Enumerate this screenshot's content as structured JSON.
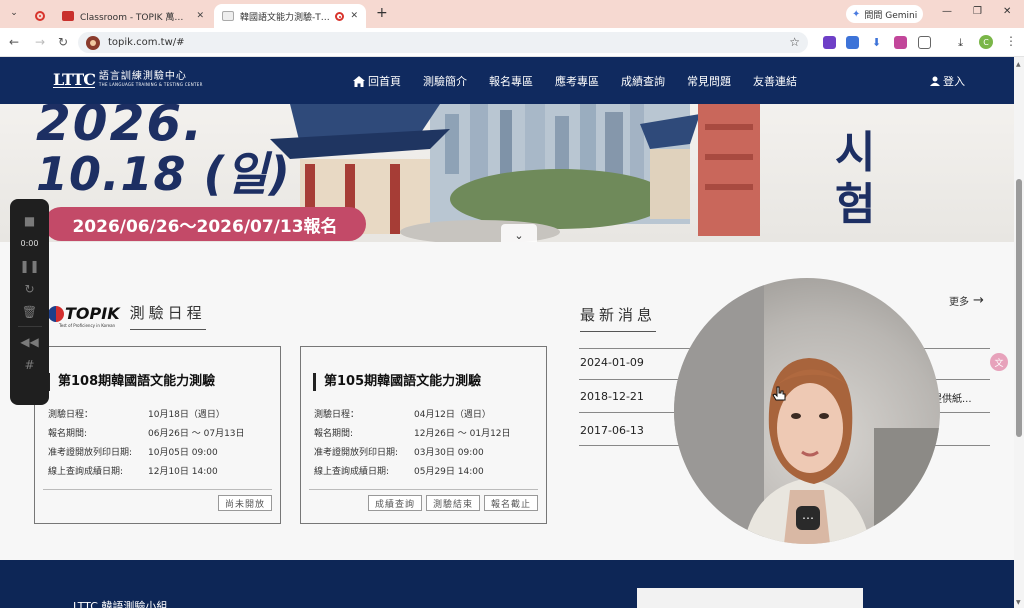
{
  "browser": {
    "tabs": [
      {
        "title": "",
        "type": "recording"
      },
      {
        "title": "Classroom - TOPIK 萬事屋 | Sc",
        "type": "tab"
      },
      {
        "title": "韓國語文能力測驗-TOPIK",
        "type": "tab",
        "active": true
      }
    ],
    "new_tab_label": "+",
    "gemini_label": "問問 Gemini",
    "url": "topik.com.tw/#",
    "profile_initial": "C"
  },
  "site": {
    "logo_mark": "LTTC",
    "logo_name": "語言訓練測驗中心",
    "logo_en": "THE LANGUAGE TRAINING & TESTING CENTER",
    "menu": [
      "回首頁",
      "測驗簡介",
      "報名專區",
      "應考專區",
      "成績查詢",
      "常見問題",
      "友善連結"
    ],
    "login_label": "登入"
  },
  "banner": {
    "year": "2026.",
    "day": "10.18 (일)",
    "registration": "2026/06/26～2026/07/13報名",
    "korean_chars": [
      "시",
      "험"
    ],
    "chevron": "⌄"
  },
  "schedule": {
    "logo_text": "TOPIK",
    "logo_sub": "Test of Proficiency in Korean",
    "title": "測驗日程",
    "cards": [
      {
        "title": "第108期韓國語文能力測驗",
        "rows": [
          {
            "k": "測驗日程：",
            "v": "10月18日（週日）"
          },
          {
            "k": "報名期間:",
            "v": "06月26日 ～ 07月13日"
          },
          {
            "k": "准考證開放列印日期:",
            "v": "10月05日 09:00"
          },
          {
            "k": "線上查詢成績日期:",
            "v": "12月10日 14:00"
          }
        ],
        "buttons": [
          "尚未開放"
        ]
      },
      {
        "title": "第105期韓國語文能力測驗",
        "rows": [
          {
            "k": "測驗日程：",
            "v": "04月12日（週日）"
          },
          {
            "k": "報名期間:",
            "v": "12月26日 ～ 01月12日"
          },
          {
            "k": "准考證開放列印日期:",
            "v": "03月30日 09:00"
          },
          {
            "k": "線上查詢成績日期:",
            "v": "05月29日 14:00"
          }
        ],
        "buttons": [
          "成績查詢",
          "測驗結束",
          "報名截止"
        ]
      }
    ]
  },
  "news": {
    "title": "最新消息",
    "more_label": "更多",
    "items": [
      {
        "date": "2024-01-09",
        "text": ""
      },
      {
        "date": "2018-12-21",
        "text": "提供紙..."
      },
      {
        "date": "2017-06-13",
        "text": ""
      }
    ]
  },
  "footer": {
    "text": "LTTC 韓語測驗小組"
  },
  "recorder": {
    "time": "0:00"
  },
  "overlays": {
    "translate_glyph": "文",
    "more_glyph": "⋯"
  }
}
